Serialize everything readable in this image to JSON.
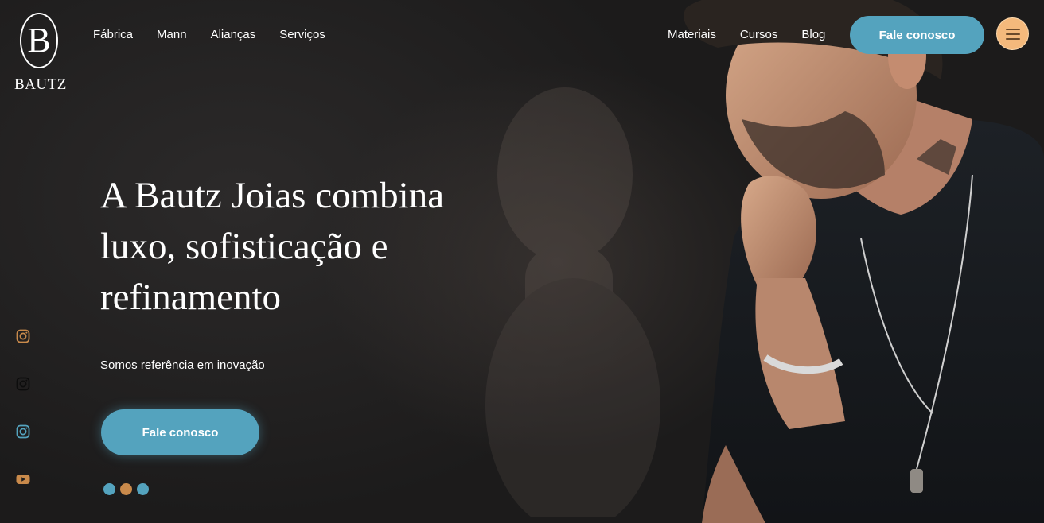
{
  "brand": {
    "logo_letter": "B",
    "logo_word": "BAUTZ"
  },
  "nav": {
    "left": [
      "Fábrica",
      "Mann",
      "Alianças",
      "Serviços"
    ],
    "right": [
      "Materiais",
      "Cursos",
      "Blog"
    ],
    "cta_label": "Fale conosco",
    "menu_icon": "hamburger-menu-icon"
  },
  "hero": {
    "headline_lines": [
      "A Bautz Joias combina",
      "luxo, sofisticação e",
      "refinamento"
    ],
    "subline": "Somos referência em inovação",
    "cta_label": "Fale conosco",
    "slider_dots": 3
  },
  "social": [
    {
      "icon": "instagram-icon",
      "color": "#c98a4b"
    },
    {
      "icon": "instagram-icon",
      "color": "#111111"
    },
    {
      "icon": "instagram-icon",
      "color": "#54a3be"
    },
    {
      "icon": "youtube-icon",
      "color": "#c98a4b"
    }
  ],
  "colors": {
    "accent_blue": "#54a3be",
    "accent_orange": "#f4b97c",
    "accent_bronze": "#c98a4b",
    "background": "#1f1e1e"
  }
}
